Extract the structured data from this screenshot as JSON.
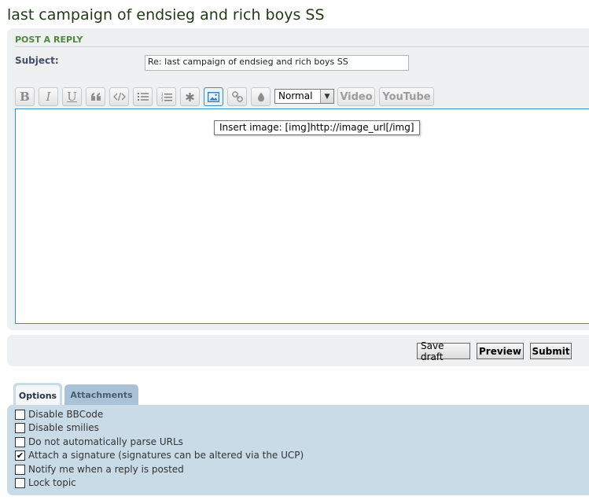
{
  "topic": {
    "title": "last campaign of endsieg and rich boys SS"
  },
  "post_form": {
    "heading": "POST A REPLY",
    "subject_label": "Subject:",
    "subject_value": "Re: last campaign of endsieg and rich boys SS"
  },
  "toolbar": {
    "bold_label": "B",
    "italic_label": "I",
    "underline_label": "U",
    "font_size_selected": "Normal",
    "video_label": "Video",
    "youtube_label": "YouTube",
    "icons": [
      "bold-icon",
      "italic-icon",
      "underline-icon",
      "quote-icon",
      "code-icon",
      "list-icon",
      "numbered-list-icon",
      "list-item-icon",
      "image-icon",
      "link-icon",
      "color-drop-icon"
    ]
  },
  "editor": {
    "tooltip": "Insert image: [img]http://image_url[/img]",
    "content": ""
  },
  "actions": {
    "save_draft_label": "Save draft",
    "preview_label": "Preview",
    "submit_label": "Submit"
  },
  "tabs": {
    "options_label": "Options",
    "attachments_label": "Attachments"
  },
  "options": [
    {
      "label": "Disable BBCode",
      "checked": false
    },
    {
      "label": "Disable smilies",
      "checked": false
    },
    {
      "label": "Do not automatically parse URLs",
      "checked": false
    },
    {
      "label": "Attach a signature (signatures can be altered via the UCP)",
      "checked": true
    },
    {
      "label": "Notify me when a reply is posted",
      "checked": false
    },
    {
      "label": "Lock topic",
      "checked": false
    }
  ],
  "colors": {
    "title": "#1f3a16",
    "heading": "#4c8a3a",
    "panel": "#eef0f1",
    "options_panel": "#c9dbe7",
    "active_border": "#3a8fc8"
  }
}
